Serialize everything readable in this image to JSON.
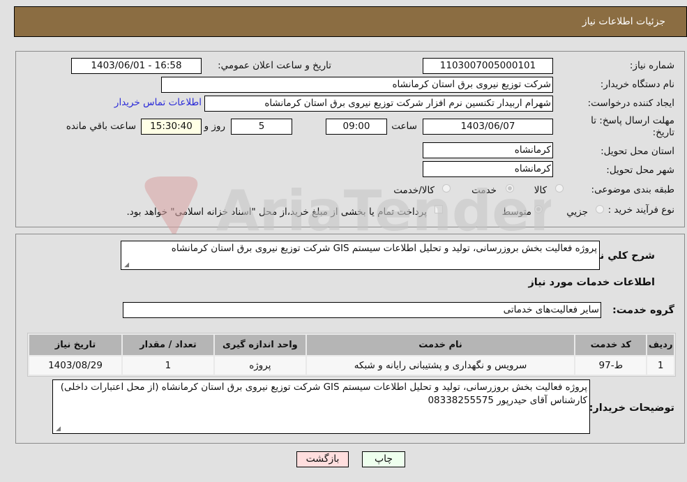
{
  "header": {
    "title": "جزئيات اطلاعات نياز"
  },
  "details": {
    "need_number": {
      "label": "شماره نياز:",
      "value": "1103007005000101"
    },
    "announce_datetime": {
      "label": "تاريخ و ساعت اعلان عمومي:",
      "value": "1403/06/01 - 16:58"
    },
    "buyer_org": {
      "label": "نام دستگاه خريدار:",
      "value": "شركت توزيع نيروی برق استان كرمانشاه"
    },
    "requester": {
      "label": "ايجاد كننده درخواست:",
      "value": "شهرام اربيدار تکنسين نرم افزار شركت توزيع نيروی برق استان كرمانشاه",
      "contact_link": "اطلاعات تماس خريدار"
    },
    "deadline": {
      "label_line1": "مهلت ارسال پاسخ: تا",
      "label_line2": "تاريخ:",
      "date": "1403/06/07",
      "time_label": "ساعت",
      "time": "09:00",
      "days": "5",
      "days_label": "روز و",
      "remaining": "15:30:40",
      "remaining_label": "ساعت باقي مانده"
    },
    "province": {
      "label": "استان محل تحويل:",
      "value": "كرمانشاه"
    },
    "city": {
      "label": "شهر محل تحويل:",
      "value": "كرمانشاه"
    },
    "category": {
      "label": "طبقه بندی موضوعی:",
      "options": [
        "كالا",
        "خدمت",
        "كالا/خدمت"
      ],
      "selected": "خدمت"
    },
    "purchase_type": {
      "label": "نوع فرآيند خريد :",
      "options": [
        "جزيي",
        "متوسط"
      ],
      "selected": "متوسط",
      "payment_note": "پرداخت تمام يا بخشی از مبلغ خريد،از محل \"اسناد خزانه اسلامی\" خواهد بود."
    }
  },
  "services": {
    "general_desc_label": "شرح کلي نياز:",
    "general_desc": "پروژه فعالیت بخش بروزرسانی، تولید و تحلیل اطلاعات سیستم GIS شرکت توزیع نیروی برق استان کرمانشاه",
    "section_title": "اطلاعات خدمات مورد نياز",
    "group_label": "گروه خدمت:",
    "group_value": "ساير فعاليت‌های خدماتی",
    "table": {
      "headers": [
        "رديف",
        "كد خدمت",
        "نام خدمت",
        "واحد اندازه گيری",
        "تعداد / مقدار",
        "تاريخ نياز"
      ],
      "rows": [
        [
          "1",
          "ط-97",
          "سرويس و نگهداری و پشتيبانی رايانه و شبكه",
          "پروژه",
          "1",
          "1403/08/29"
        ]
      ]
    },
    "buyer_notes_label": "توضيحات خريدار:",
    "buyer_notes": "پروژه فعالیت بخش بروزرسانی، تولید و تحلیل اطلاعات سیستم GIS شرکت توزیع نیروی برق استان کرمانشاه (از محل اعتبارات داخلی) کارشناس آقای حیدرپور 08338255575"
  },
  "buttons": {
    "print": "چاپ",
    "back": "بازگشت"
  },
  "watermark": {
    "text": "AriaTender.neT"
  }
}
